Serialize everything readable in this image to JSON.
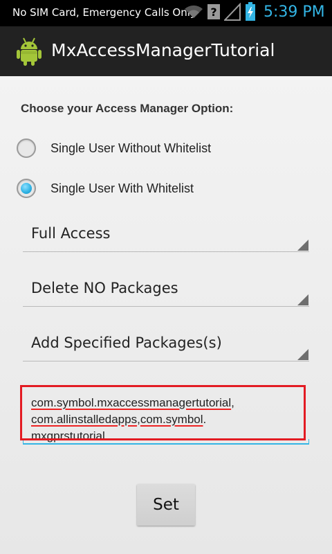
{
  "status_bar": {
    "carrier_text": "No SIM Card, Emergency Calls Only",
    "time": "5:39 PM",
    "icons": [
      "wifi-icon",
      "question-icon",
      "signal-icon",
      "battery-icon"
    ]
  },
  "action_bar": {
    "title": "MxAccessManagerTutorial",
    "icon": "android-icon"
  },
  "form": {
    "section_label": "Choose your Access Manager Option:",
    "radio_options": [
      {
        "label": "Single User Without Whitelist",
        "checked": false
      },
      {
        "label": "Single User With Whitelist",
        "checked": true
      }
    ],
    "spinners": [
      {
        "value": "Full Access"
      },
      {
        "value": "Delete NO Packages"
      },
      {
        "value": "Add Specified Packages(s)"
      }
    ],
    "packages_input": {
      "parts": [
        "com.symbol.mxaccessmanagertutorial",
        ",",
        "com.allinstalledapps",
        ",",
        "com.symbol",
        ".",
        "mxgprstutorial"
      ]
    },
    "set_button": "Set"
  },
  "colors": {
    "accent": "#33b5e5",
    "highlight": "#e31b23",
    "action_bar": "#222222"
  }
}
